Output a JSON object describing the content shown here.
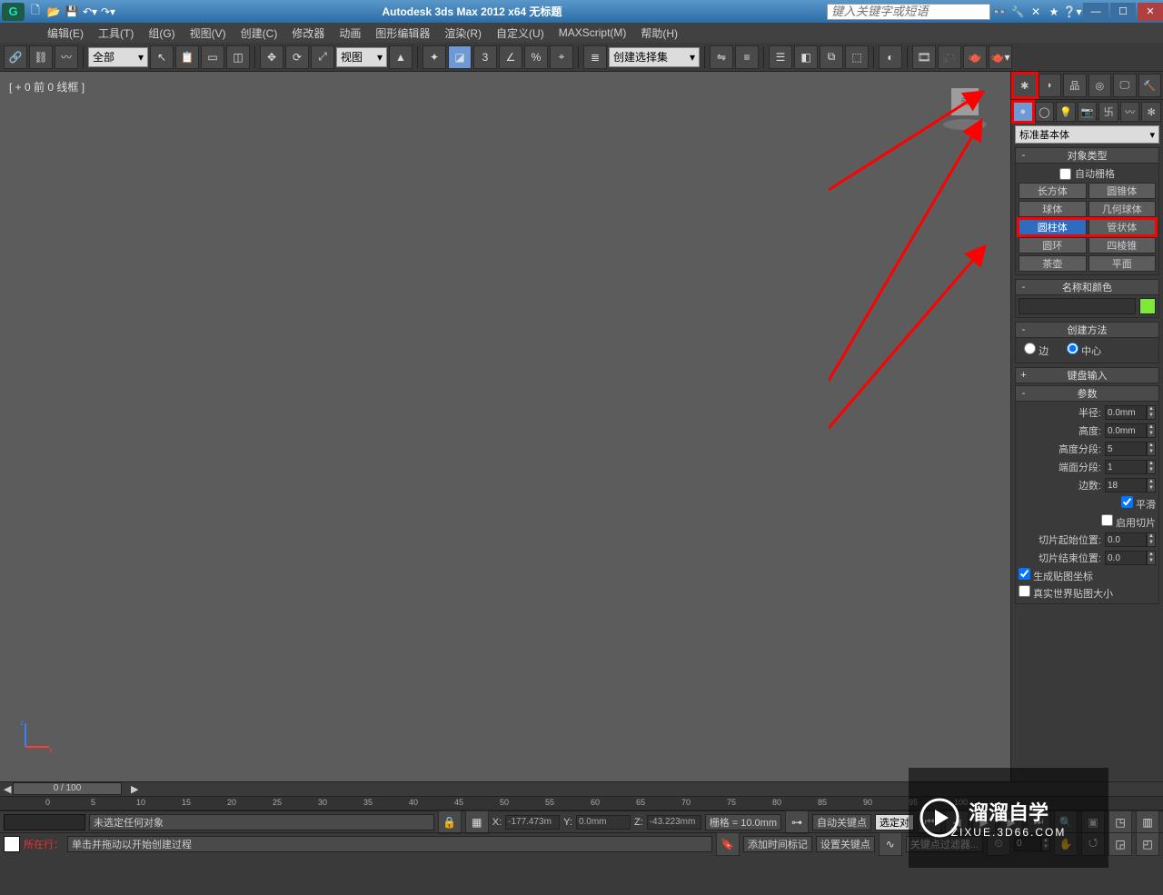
{
  "titlebar": {
    "app_abbrev": "G",
    "title": "Autodesk 3ds Max  2012 x64    无标题",
    "search_placeholder": "键入关键字或短语",
    "min": "—",
    "max": "☐",
    "close": "✕"
  },
  "menu": [
    "编辑(E)",
    "工具(T)",
    "组(G)",
    "视图(V)",
    "创建(C)",
    "修改器",
    "动画",
    "图形编辑器",
    "渲染(R)",
    "自定义(U)",
    "MAXScript(M)",
    "帮助(H)"
  ],
  "toolbar": {
    "combo1": "全部",
    "combo2": "视图",
    "combo3": "创建选择集"
  },
  "viewport": {
    "label": "[ + 0 前 0 线框 ]"
  },
  "cmdpanel": {
    "dropdown": "标准基本体",
    "objtype_head": "对象类型",
    "autogrid": "自动栅格",
    "buttons": [
      [
        "长方体",
        "圆锥体"
      ],
      [
        "球体",
        "几何球体"
      ],
      [
        "圆柱体",
        "管状体"
      ],
      [
        "圆环",
        "四棱锥"
      ],
      [
        "茶壶",
        "平面"
      ]
    ],
    "namecolor_head": "名称和颜色",
    "createmethod_head": "创建方法",
    "radio_edge": "边",
    "radio_center": "中心",
    "keyboard_head": "键盘输入",
    "params_head": "参数",
    "radius_label": "半径:",
    "radius_val": "0.0mm",
    "height_label": "高度:",
    "height_val": "0.0mm",
    "hseg_label": "高度分段:",
    "hseg_val": "5",
    "cseg_label": "端面分段:",
    "cseg_val": "1",
    "sides_label": "边数:",
    "sides_val": "18",
    "smooth": "平滑",
    "enable_slice": "启用切片",
    "slice_from_label": "切片起始位置:",
    "slice_from_val": "0.0",
    "slice_to_label": "切片结束位置:",
    "slice_to_val": "0.0",
    "gen_uv": "生成贴图坐标",
    "real_uv": "真实世界贴图大小"
  },
  "timeline": {
    "thumb": "0 / 100",
    "ticks": [
      "0",
      "5",
      "10",
      "15",
      "20",
      "25",
      "30",
      "35",
      "40",
      "45",
      "50",
      "55",
      "60",
      "65",
      "70",
      "75",
      "80",
      "85",
      "90",
      "95",
      "100"
    ]
  },
  "status": {
    "none_selected": "未选定任何对象",
    "x_val": "-177.473m",
    "y_val": "0.0mm",
    "z_val": "-43.223mm",
    "grid": "栅格 = 10.0mm",
    "autokey": "自动关键点",
    "selkey": "选定对",
    "prompt": "单击并拖动以开始创建过程",
    "addtime": "添加时间标记",
    "setkey": "设置关键点",
    "keyfilter": "关键点过滤器...",
    "spinner_val": "0",
    "current_line_label": "所在行："
  },
  "watermark": {
    "brand": "溜溜自学",
    "url": "ZIXUE.3D66.COM"
  }
}
